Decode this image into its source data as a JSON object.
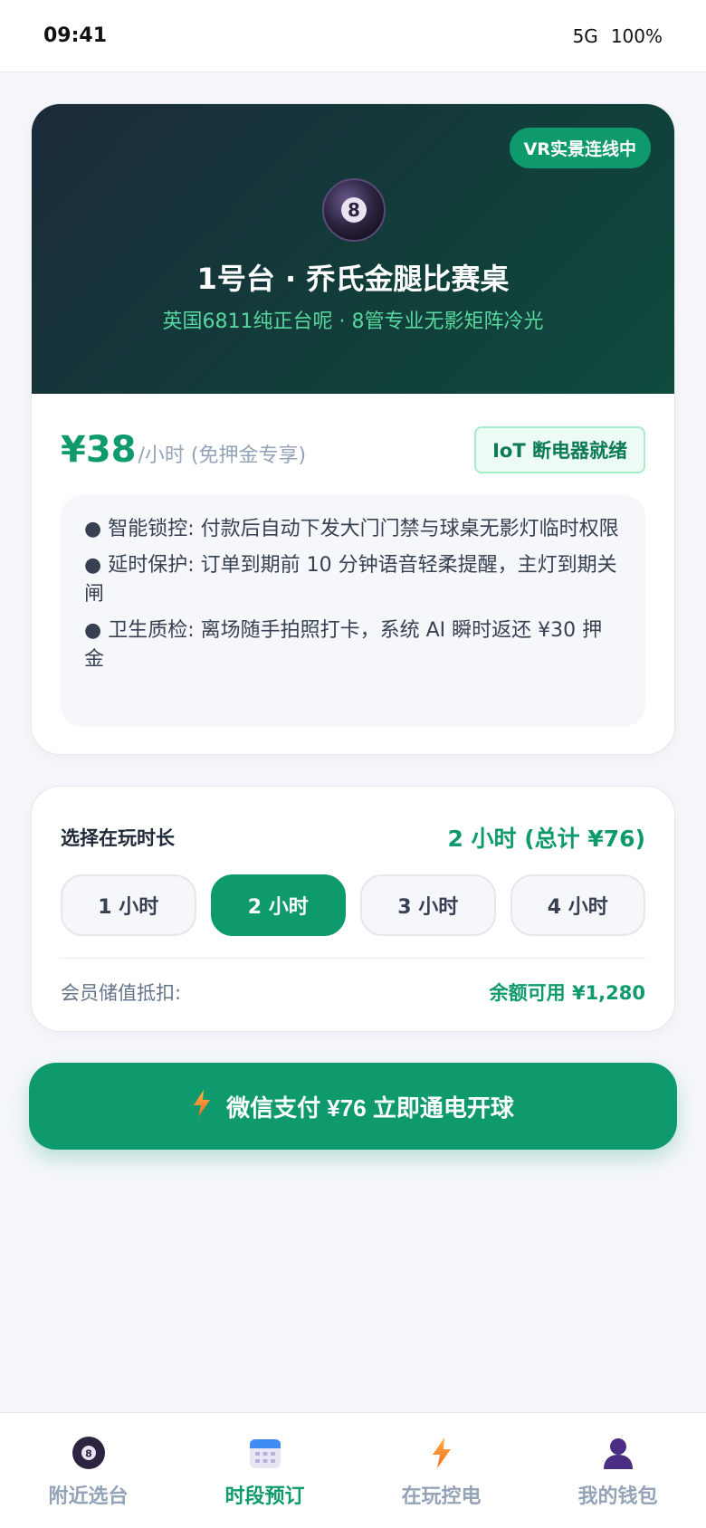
{
  "status_bar": {
    "time": "09:41",
    "network": "5G",
    "battery": "100%"
  },
  "table": {
    "vr_badge": "VR实景连线中",
    "ball_icon": "8-ball-icon",
    "title": "1号台 · 乔氏金腿比赛桌",
    "subtitle": "英国6811纯正台呢 · 8管专业无影矩阵冷光",
    "price": "¥38",
    "price_unit": "/小时 (免押金专享)",
    "iot_badge": "IoT 断电器就绪",
    "features": [
      "● 智能锁控: 付款后自动下发大门门禁与球桌无影灯临时权限",
      "● 延时保护: 订单到期前 10 分钟语音轻柔提醒，主灯到期关闸",
      "● 卫生质检: 离场随手拍照打卡，系统 AI 瞬时返还 ¥30 押金"
    ]
  },
  "duration": {
    "label": "选择在玩时长",
    "total": "2 小时 (总计 ¥76)",
    "options": [
      "1 小时",
      "2 小时",
      "3 小时",
      "4 小时"
    ],
    "selected_index": 1,
    "member_label": "会员储值抵扣:",
    "member_balance": "余额可用 ¥1,280"
  },
  "pay_button": {
    "icon": "lightning-icon",
    "label": "微信支付 ¥76 立即通电开球"
  },
  "tabs": [
    {
      "label": "附近选台",
      "icon": "8-ball-icon",
      "active": false
    },
    {
      "label": "时段预订",
      "icon": "calendar-icon",
      "active": true
    },
    {
      "label": "在玩控电",
      "icon": "lightning-icon",
      "active": false
    },
    {
      "label": "我的钱包",
      "icon": "user-icon",
      "active": false
    }
  ],
  "colors": {
    "accent": "#0e9a6c",
    "hero_start": "#1c2a3a",
    "hero_end": "#0e4a3d"
  }
}
